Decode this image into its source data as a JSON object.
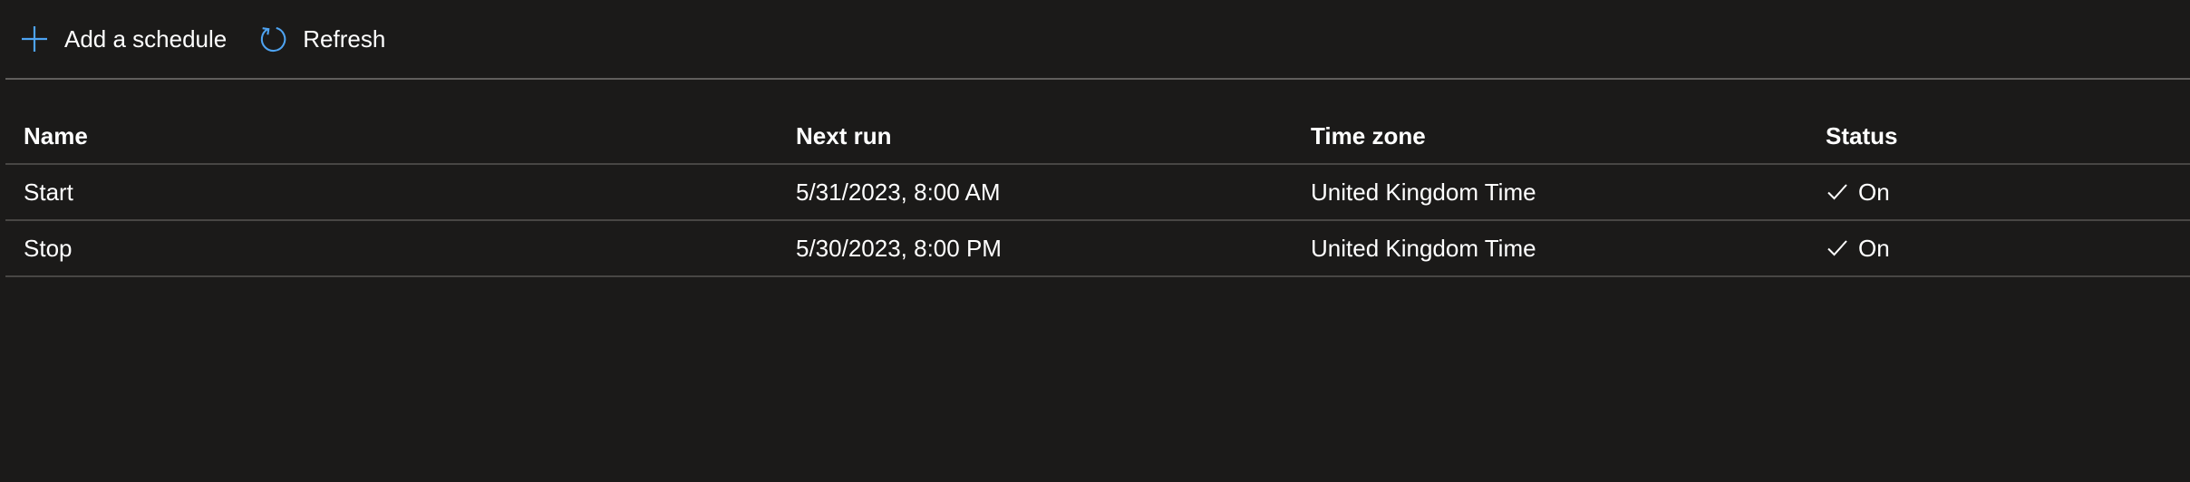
{
  "toolbar": {
    "add_label": "Add a schedule",
    "refresh_label": "Refresh",
    "accent_color": "#4ea3f1"
  },
  "table": {
    "columns": [
      "Name",
      "Next run",
      "Time zone",
      "Status"
    ],
    "rows": [
      {
        "name": "Start",
        "next_run": "5/31/2023, 8:00 AM",
        "time_zone": "United Kingdom Time",
        "status": "On",
        "status_icon": "checkmark-icon"
      },
      {
        "name": "Stop",
        "next_run": "5/30/2023, 8:00 PM",
        "time_zone": "United Kingdom Time",
        "status": "On",
        "status_icon": "checkmark-icon"
      }
    ]
  },
  "colors": {
    "background": "#1b1a19",
    "text": "#ffffff",
    "divider": "#605e5c"
  }
}
